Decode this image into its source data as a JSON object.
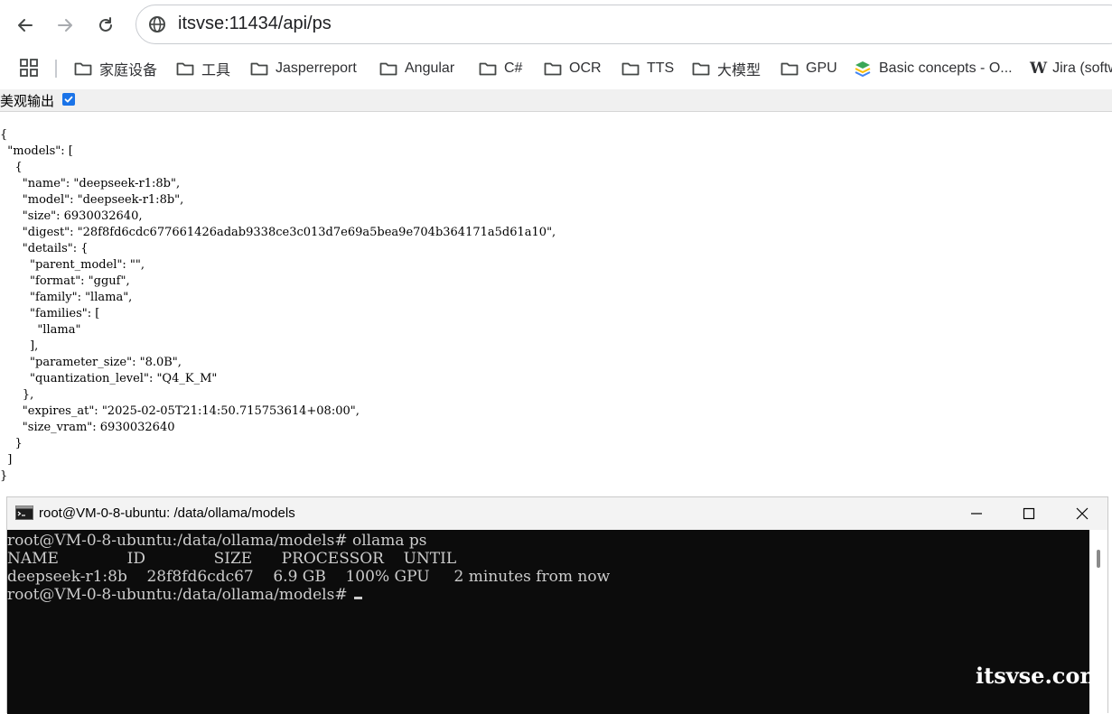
{
  "browser": {
    "url": "itsvse:11434/api/ps",
    "bookmarks": [
      {
        "label": "家庭设备",
        "icon": "folder-icon"
      },
      {
        "label": "工具",
        "icon": "folder-icon"
      },
      {
        "label": "Jasperreport",
        "icon": "folder-icon"
      },
      {
        "label": "Angular",
        "icon": "folder-icon"
      },
      {
        "label": "C#",
        "icon": "folder-icon"
      },
      {
        "label": "OCR",
        "icon": "folder-icon"
      },
      {
        "label": "TTS",
        "icon": "folder-icon"
      },
      {
        "label": "大模型",
        "icon": "folder-icon"
      },
      {
        "label": "GPU",
        "icon": "folder-icon"
      },
      {
        "label": "Basic concepts - O...",
        "icon": "layers-icon"
      },
      {
        "label": "Jira (softw",
        "icon": "w-icon"
      }
    ]
  },
  "page": {
    "pretty_label": "美观输出",
    "pretty_checked": true,
    "json_lines": [
      "{",
      "  \"models\": [",
      "    {",
      "      \"name\": \"deepseek-r1:8b\",",
      "      \"model\": \"deepseek-r1:8b\",",
      "      \"size\": 6930032640,",
      "      \"digest\": \"28f8fd6cdc677661426adab9338ce3c013d7e69a5bea9e704b364171a5d61a10\",",
      "      \"details\": {",
      "        \"parent_model\": \"\",",
      "        \"format\": \"gguf\",",
      "        \"family\": \"llama\",",
      "        \"families\": [",
      "          \"llama\"",
      "        ],",
      "        \"parameter_size\": \"8.0B\",",
      "        \"quantization_level\": \"Q4_K_M\"",
      "      },",
      "      \"expires_at\": \"2025-02-05T21:14:50.715753614+08:00\",",
      "      \"size_vram\": 6930032640",
      "    }",
      "  ]",
      "}"
    ]
  },
  "terminal": {
    "title": "root@VM-0-8-ubuntu: /data/ollama/models",
    "lines": [
      "root@VM-0-8-ubuntu:/data/ollama/models# ollama ps",
      "NAME              ID              SIZE      PROCESSOR    UNTIL",
      "deepseek-r1:8b    28f8fd6cdc67    6.9 GB    100% GPU     2 minutes from now",
      "root@VM-0-8-ubuntu:/data/ollama/models# "
    ]
  },
  "watermark": "itsvse.com",
  "colors": {
    "accent": "#1a73e8",
    "terminal_bg": "#0c0c0c",
    "terminal_text": "#cccccc",
    "folder": "#444746"
  }
}
